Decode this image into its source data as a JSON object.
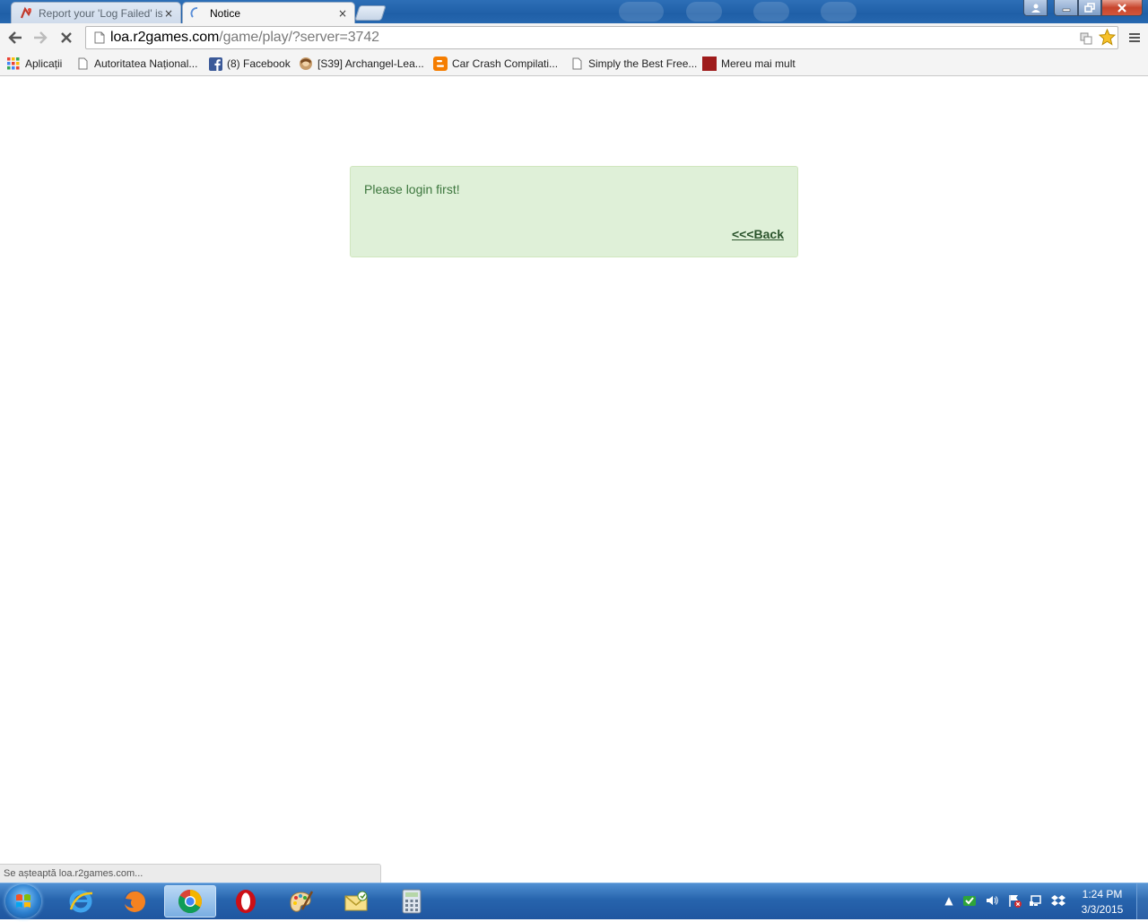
{
  "window": {
    "tabs": [
      {
        "title": "Report your 'Log Failed' is",
        "active": false,
        "close": "×",
        "icon": "r2-logo-icon"
      },
      {
        "title": "Notice",
        "active": true,
        "close": "×",
        "icon": "loading-spinner-icon"
      }
    ],
    "controls": {
      "minimize": "minimize-icon",
      "maximize": "restore-icon",
      "close": "close-icon"
    }
  },
  "toolbar": {
    "url_host": "loa.r2games.com",
    "url_rest": "/game/play/?server=3742"
  },
  "bookmarks": [
    {
      "label": "Aplicații",
      "icon": "apps-grid-icon"
    },
    {
      "label": "Autoritatea Național...",
      "icon": "page-icon"
    },
    {
      "label": "(8) Facebook",
      "icon": "facebook-icon"
    },
    {
      "label": "[S39] Archangel-Lea...",
      "icon": "game-avatar-icon"
    },
    {
      "label": "Car Crash Compilati...",
      "icon": "blogger-icon"
    },
    {
      "label": "Simply the Best Free...",
      "icon": "page-icon"
    },
    {
      "label": "Mereu mai mult",
      "icon": "red-square-icon"
    }
  ],
  "notice": {
    "message": "Please login first!",
    "back_link": "<<<Back",
    "bg_color": "#dff0d8",
    "text_color": "#3c763d"
  },
  "status_bar": {
    "text": "Se așteaptă loa.r2games.com..."
  },
  "taskbar": {
    "pinned": [
      "internet-explorer-icon",
      "firefox-icon",
      "chrome-icon",
      "opera-icon",
      "paint-icon",
      "mail-icon",
      "calculator-icon"
    ],
    "active_app": "chrome-icon",
    "clock_time": "1:24 PM",
    "clock_date": "3/3/2015"
  }
}
